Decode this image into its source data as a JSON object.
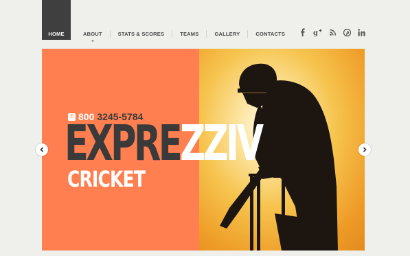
{
  "nav": {
    "items": [
      {
        "label": "HOME",
        "active": true
      },
      {
        "label": "ABOUT",
        "has_dropdown": true
      },
      {
        "label": "STATS & SCORES"
      },
      {
        "label": "TEAMS"
      },
      {
        "label": "GALLERY"
      },
      {
        "label": "CONTACTS"
      }
    ]
  },
  "social": {
    "icons": [
      {
        "name": "facebook-icon",
        "glyph": "f"
      },
      {
        "name": "google-plus-icon",
        "glyph": "g+"
      },
      {
        "name": "rss-icon",
        "glyph": "rss"
      },
      {
        "name": "pinterest-icon",
        "glyph": "p"
      },
      {
        "name": "linkedin-icon",
        "glyph": "in"
      }
    ]
  },
  "slider": {
    "phone_prefix": "800",
    "phone_number": "3245-5784",
    "headline_dark": "EXPRE",
    "headline_light": "ZZIV",
    "subhead": "CRICKET",
    "prev_icon": "chevron-left-icon",
    "next_icon": "chevron-right-icon"
  },
  "colors": {
    "accent": "#ff7f50",
    "nav_active_bg": "#3f3f3f",
    "dark_text": "#3a3a3a",
    "background": "#efefec"
  }
}
